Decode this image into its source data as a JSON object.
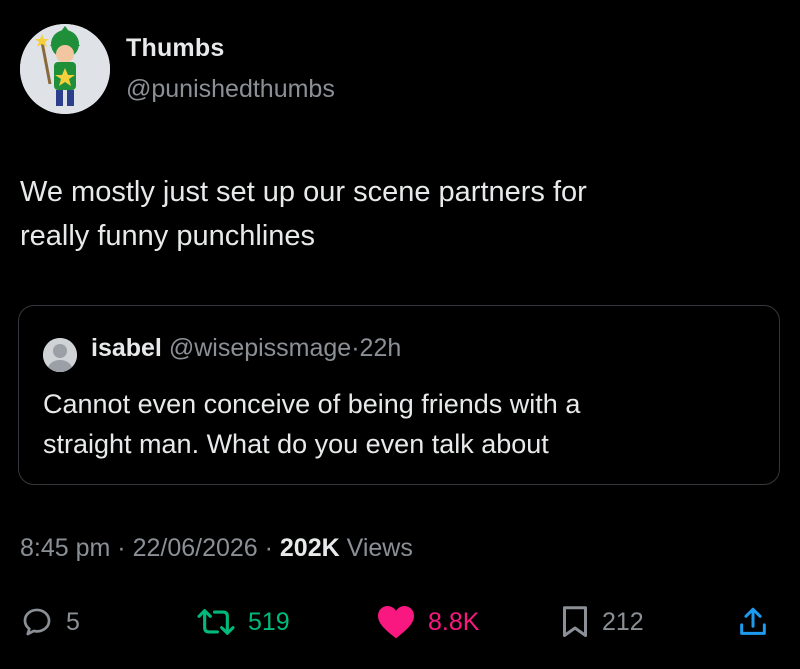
{
  "author": {
    "display_name": "Thumbs",
    "handle": "@punishedthumbs",
    "avatar_icon": "wizard-character-avatar"
  },
  "tweet": {
    "text_line1": "We mostly just set up our scene partners for",
    "text_line2": "really funny punchlines"
  },
  "quote": {
    "name": "isabel",
    "handle": "@wisepissmage",
    "separator": "·",
    "time": "22h",
    "text_line1": "Cannot even conceive of being friends with a",
    "text_line2": "straight man. What do you even talk about",
    "avatar_icon": "user-photo-avatar"
  },
  "meta": {
    "time": "8:45 pm",
    "separator1": " · ",
    "date": "22/06/2026",
    "separator2": " · ",
    "views_count": "202K",
    "views_label": " Views"
  },
  "actions": {
    "reply_count": "5",
    "retweet_count": "519",
    "like_count": "8.8K",
    "bookmark_count": "212"
  },
  "colors": {
    "background": "#000000",
    "primary_text": "#e7e9ea",
    "secondary_text": "#8b9096",
    "retweet_green": "#00ba7c",
    "like_pink": "#f91880",
    "share_blue": "#1d9bf0",
    "border": "#34383c"
  }
}
